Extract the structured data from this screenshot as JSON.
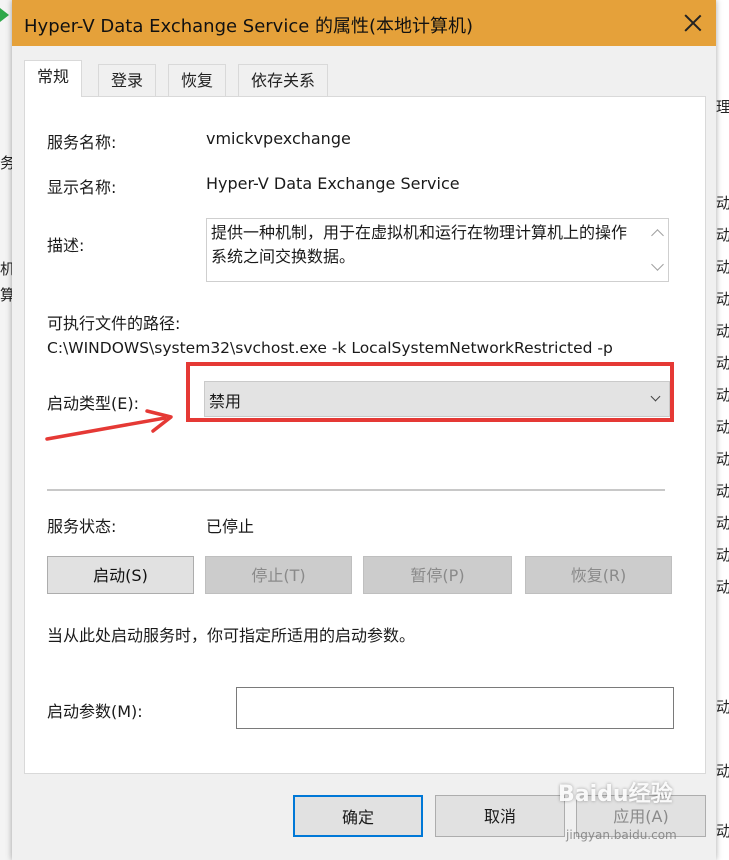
{
  "background": {
    "left_glyphs": [
      "务",
      "机",
      "算"
    ],
    "right_glyphs": [
      "理",
      "动",
      "动",
      "动",
      "动",
      "动",
      "动",
      "动",
      "动",
      "动",
      "动",
      "动",
      "动",
      "动",
      "动",
      "动",
      "动"
    ]
  },
  "window": {
    "title": "Hyper-V Data Exchange Service 的属性(本地计算机)",
    "titlebar_color": "#e5a13a"
  },
  "tabs": [
    {
      "label": "常规",
      "active": true
    },
    {
      "label": "登录",
      "active": false
    },
    {
      "label": "恢复",
      "active": false
    },
    {
      "label": "依存关系",
      "active": false
    }
  ],
  "general": {
    "service_name_label": "服务名称:",
    "service_name_value": "vmickvpexchange",
    "display_name_label": "显示名称:",
    "display_name_value": "Hyper-V Data Exchange Service",
    "description_label": "描述:",
    "description_value": "提供一种机制，用于在虚拟机和运行在物理计算机上的操作系统之间交换数据。",
    "path_label": "可执行文件的路径:",
    "path_value": "C:\\WINDOWS\\system32\\svchost.exe -k LocalSystemNetworkRestricted -p",
    "startup_type_label": "启动类型(E):",
    "startup_type_value": "禁用",
    "status_label": "服务状态:",
    "status_value": "已停止",
    "hint": "当从此处启动服务时，你可指定所适用的启动参数。",
    "params_label": "启动参数(M):",
    "params_value": ""
  },
  "control_buttons": [
    {
      "label": "启动(S)",
      "enabled": true
    },
    {
      "label": "停止(T)",
      "enabled": false
    },
    {
      "label": "暂停(P)",
      "enabled": false
    },
    {
      "label": "恢复(R)",
      "enabled": false
    }
  ],
  "footer": {
    "ok_label": "确定",
    "cancel_label": "取消",
    "apply_label": "应用(A)"
  },
  "annotation": {
    "highlight_color": "#e53935"
  },
  "watermark": {
    "brand": "Baidu经验",
    "url": "jingyan.baidu.com"
  }
}
